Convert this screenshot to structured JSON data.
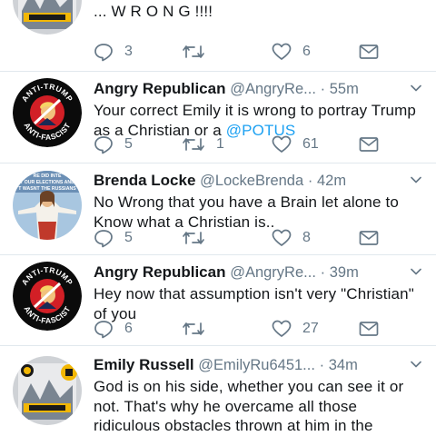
{
  "tweets": [
    {
      "avatar": "pittsburgh-sports-logo",
      "name": "",
      "handle": "",
      "time": "",
      "text": "... W R O N G !!!!",
      "mention": "",
      "replies": "3",
      "retweets": "",
      "likes": "6"
    },
    {
      "avatar": "anti-trump-anti-fascist-logo",
      "name": "Angry Republican",
      "handle": "@AngryRe...",
      "time": "· 55m",
      "text": "Your correct Emily it is wrong to portray Trump as a Christian or a ",
      "mention": "@POTUS",
      "replies": "5",
      "retweets": "1",
      "likes": "61"
    },
    {
      "avatar": "jesus-russians-meme",
      "name": "Brenda Locke",
      "handle": "@LockeBrenda",
      "time": "· 42m",
      "text": "No Wrong that you have a Brain let alone to Know what a Christian is..",
      "mention": "",
      "replies": "5",
      "retweets": "",
      "likes": "8"
    },
    {
      "avatar": "anti-trump-anti-fascist-logo",
      "name": "Angry Republican",
      "handle": "@AngryRe...",
      "time": "· 39m",
      "text": "Hey now that assumption isn't very \"Christian\" of you",
      "mention": "",
      "replies": "6",
      "retweets": "",
      "likes": "27"
    },
    {
      "avatar": "pittsburgh-sports-logo",
      "name": "Emily Russell",
      "handle": "@EmilyRu6451...",
      "time": "· 34m",
      "text": "God is on his side, whether you can see it or not. That's why he overcame all those ridiculous obstacles thrown at him in the election.",
      "mention": "",
      "replies": "",
      "retweets": "",
      "likes": ""
    }
  ],
  "avatar_text": {
    "anti_trump_top": "ANTI-TRUMP",
    "anti_trump_bottom": "ANTI-FASCIST",
    "jesus_line1": "RE DID INTE",
    "jesus_line2": "T OUR ELECTIONS AND",
    "jesus_line3": "T WASNT THE RUSSIANS"
  },
  "colors": {
    "text": "#14171a",
    "secondary": "#657786",
    "link": "#1da1f2",
    "divider": "#e1e8ed",
    "icon": "#657786"
  }
}
